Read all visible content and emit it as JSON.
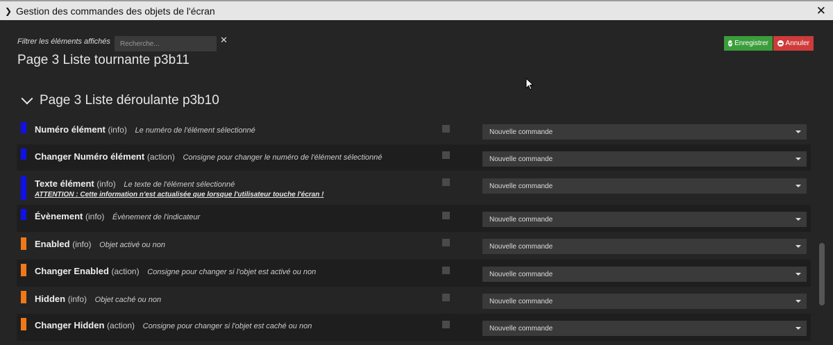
{
  "window": {
    "title": "Gestion des commandes des objets de l'écran"
  },
  "filter": {
    "label": "Filtrer les éléments affichés",
    "placeholder": "Recherche..."
  },
  "buttons": {
    "save": "Enregistrer",
    "cancel": "Annuler"
  },
  "sections": {
    "previous_title": "Page 3 Liste tournante p3b11",
    "current_title": "Page 3 Liste déroulante p3b10"
  },
  "colors": {
    "info": "#1010e8",
    "action_blue": "#1010e8",
    "orange": "#f07818",
    "save": "#3a9d3a",
    "cancel": "#cf3b3b"
  },
  "rows": [
    {
      "name": "Numéro élément",
      "type": "(info)",
      "desc": "Le numéro de l'élément sélectionné",
      "command": "Nouvelle commande"
    },
    {
      "name": "Changer Numéro élément",
      "type": "(action)",
      "desc": "Consigne pour changer le numéro de l'élément sélectionné",
      "command": "Nouvelle commande"
    },
    {
      "name": "Texte élément",
      "type": "(info)",
      "desc": "Le texte de l'élément sélectionné",
      "warning": "ATTENTION : Cette information n'est actualisée que lorsque l'utilisateur touche l'écran !",
      "command": "Nouvelle commande"
    },
    {
      "name": "Évènement",
      "type": "(info)",
      "desc": "Évènement de l'indicateur",
      "command": "Nouvelle commande"
    },
    {
      "name": "Enabled",
      "type": "(info)",
      "desc": "Objet activé ou non",
      "command": "Nouvelle commande"
    },
    {
      "name": "Changer Enabled",
      "type": "(action)",
      "desc": "Consigne pour changer si l'objet est activé ou non",
      "command": "Nouvelle commande"
    },
    {
      "name": "Hidden",
      "type": "(info)",
      "desc": "Objet caché ou non",
      "command": "Nouvelle commande"
    },
    {
      "name": "Changer Hidden",
      "type": "(action)",
      "desc": "Consigne pour changer si l'objet est caché ou non",
      "command": "Nouvelle commande"
    }
  ]
}
